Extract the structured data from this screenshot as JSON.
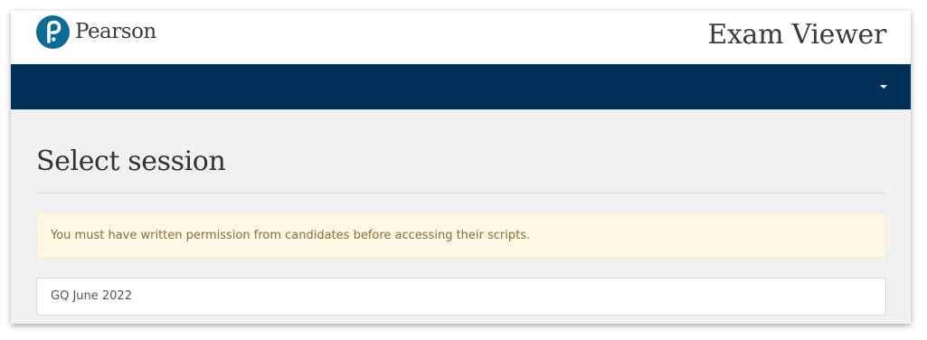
{
  "header": {
    "logo_text": "Pearson",
    "logo_icon": "pearson-logo-icon",
    "app_title": "Exam Viewer"
  },
  "navbar": {
    "menu_icon": "caret-down-icon",
    "background_color": "#003057"
  },
  "main": {
    "page_title": "Select session",
    "alert": {
      "message": "You must have written permission from candidates before accessing their scripts.",
      "background_color": "#fcf8e3",
      "text_color": "#8a6d3b"
    },
    "session_select": {
      "value": "GQ June 2022"
    }
  },
  "colors": {
    "brand": "#0d6c96",
    "navbar": "#003057",
    "page_background": "#f1f1f1"
  }
}
